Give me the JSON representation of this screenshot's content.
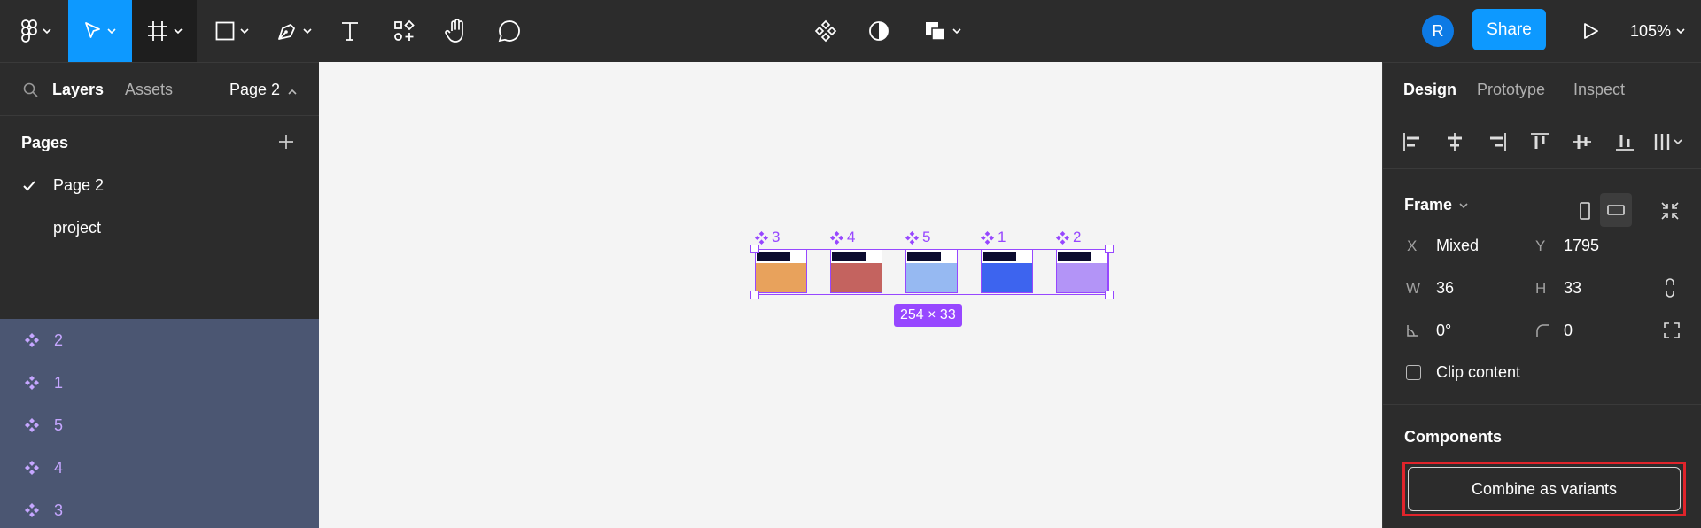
{
  "toolbar": {
    "tools": [
      "main-menu",
      "move",
      "frame",
      "shape",
      "pen",
      "text",
      "resources",
      "hand",
      "comment"
    ],
    "avatar_initial": "R",
    "share_label": "Share",
    "zoom": "105%"
  },
  "left_panel": {
    "tab_layers": "Layers",
    "tab_assets": "Assets",
    "page_selector": "Page 2",
    "pages_title": "Pages",
    "pages": [
      {
        "name": "Page 2",
        "active": true
      },
      {
        "name": "project",
        "active": false
      }
    ],
    "layers": [
      "2",
      "1",
      "5",
      "4",
      "3"
    ]
  },
  "canvas": {
    "components": [
      {
        "label": "3",
        "color": "#e8a25c"
      },
      {
        "label": "4",
        "color": "#c4635f"
      },
      {
        "label": "5",
        "color": "#96b9f2"
      },
      {
        "label": "1",
        "color": "#3d64ef"
      },
      {
        "label": "2",
        "color": "#b394f7"
      }
    ],
    "selection_size": "254 × 33",
    "selection_color": "#9747ff"
  },
  "right_panel": {
    "tab_design": "Design",
    "tab_prototype": "Prototype",
    "tab_inspect": "Inspect",
    "frame_title": "Frame",
    "x_label": "X",
    "x_value": "Mixed",
    "y_label": "Y",
    "y_value": "1795",
    "w_label": "W",
    "w_value": "36",
    "h_label": "H",
    "h_value": "33",
    "rotation": "0°",
    "radius": "0",
    "clip_content": "Clip content",
    "components_title": "Components",
    "combine_label": "Combine as variants"
  }
}
